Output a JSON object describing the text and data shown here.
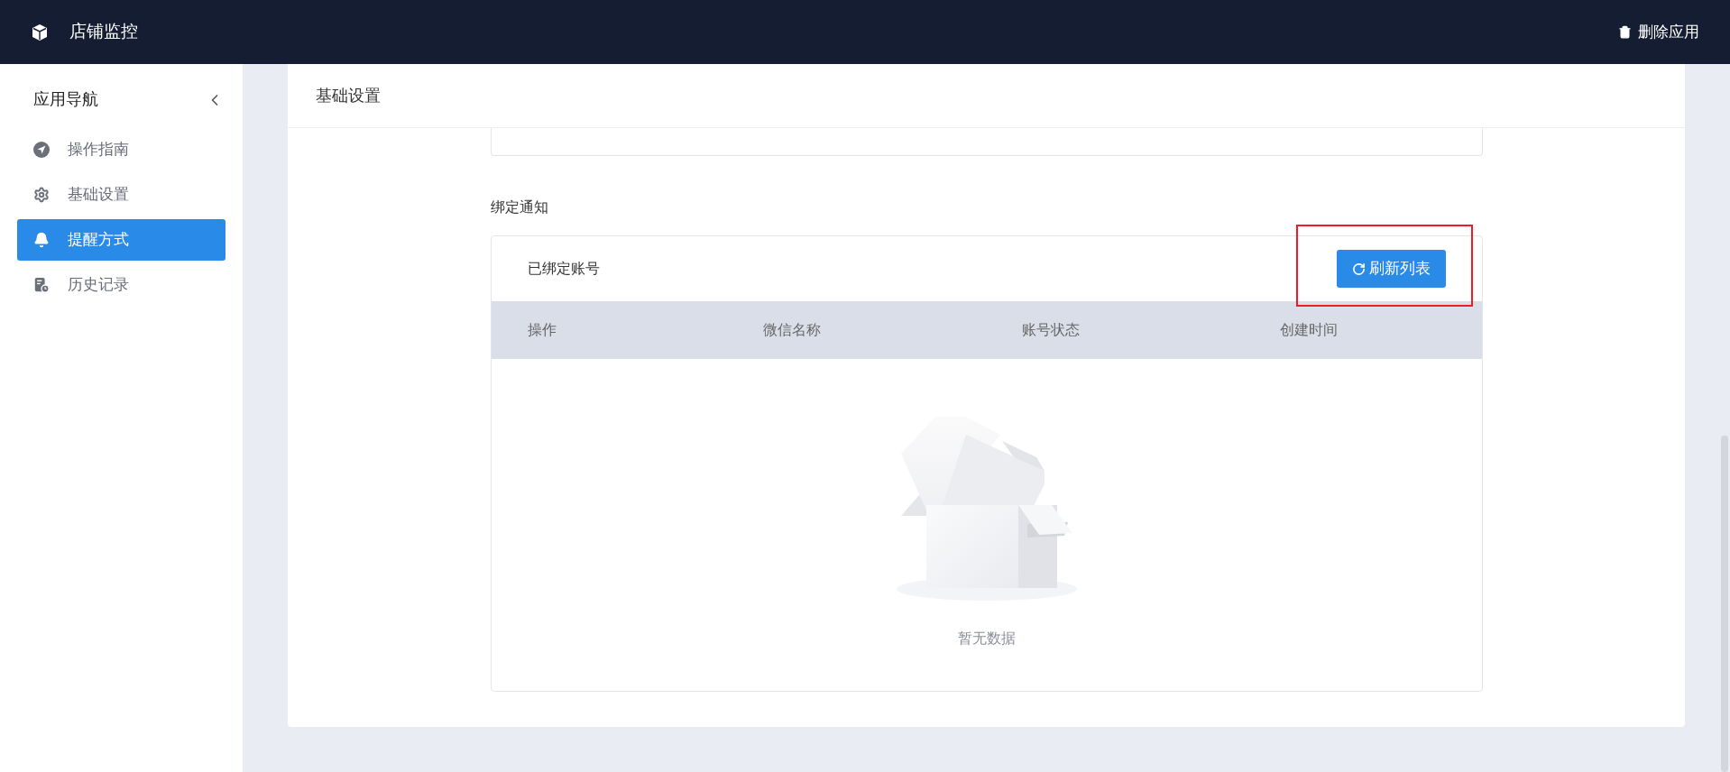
{
  "top_bar": {
    "app_title": "店铺监控",
    "delete_action": "删除应用"
  },
  "sidebar": {
    "title": "应用导航",
    "items": [
      {
        "label": "操作指南",
        "selected": false
      },
      {
        "label": "基础设置",
        "selected": false
      },
      {
        "label": "提醒方式",
        "selected": true
      },
      {
        "label": "历史记录",
        "selected": false
      }
    ]
  },
  "page": {
    "tab_title": "基础设置",
    "section_title": "绑定通知",
    "table": {
      "title": "已绑定账号",
      "refresh_button": "刷新列表",
      "highlighted": true,
      "columns": [
        "操作",
        "微信名称",
        "账号状态",
        "创建时间"
      ],
      "empty_text": "暂无数据"
    }
  }
}
